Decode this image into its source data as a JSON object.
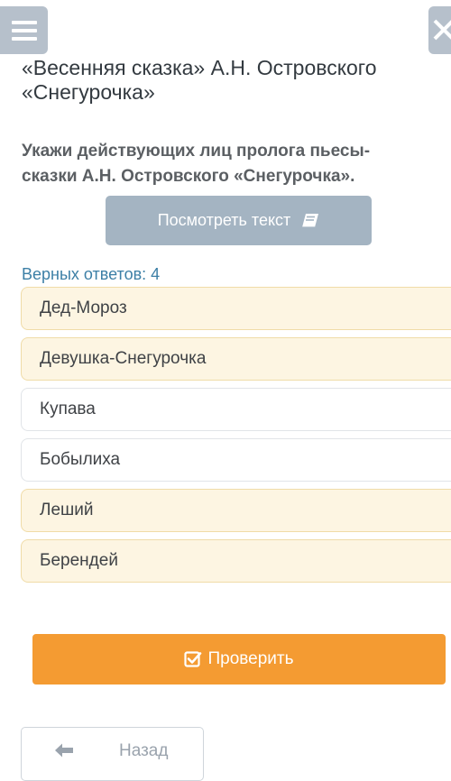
{
  "header": {
    "menu_icon": "hamburger-menu-icon",
    "close_icon": "close-icon"
  },
  "lesson": {
    "title_line1": "«Весенняя сказка» А.Н. Островского",
    "title_line2": "«Снегурочка»"
  },
  "question": {
    "line1": "Укажи действующих лиц пролога пьесы-",
    "line2": "сказки А.Н. Островского «Снегурочка»."
  },
  "view_text_button": {
    "label": "Посмотреть текст",
    "icon": "book-icon"
  },
  "correct_answers": {
    "text": "Верных ответов: 4"
  },
  "options": [
    {
      "label": "Дед-Мороз",
      "selected": true
    },
    {
      "label": "Девушка-Снегурочка",
      "selected": true
    },
    {
      "label": "Купава",
      "selected": false
    },
    {
      "label": "Бобылиха",
      "selected": false
    },
    {
      "label": "Леший",
      "selected": true
    },
    {
      "label": "Берендей",
      "selected": true
    }
  ],
  "check_button": {
    "label": "Проверить",
    "icon": "checkbox-icon"
  },
  "back_button": {
    "label": "Назад",
    "icon": "arrow-left-icon"
  },
  "colors": {
    "accent_orange": "#f49b32",
    "selected_option_bg": "#fdf5e2",
    "selected_option_border": "#f0dca8",
    "info_blue": "#3c7fa6",
    "header_button_gray": "#b6c0cb"
  }
}
